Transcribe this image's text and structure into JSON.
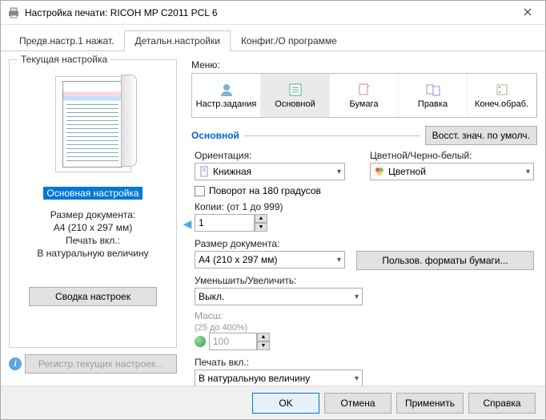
{
  "window": {
    "title": "Настройка печати: RICOH MP C2011 PCL 6"
  },
  "tabs": {
    "t1": "Предв.настр.1 нажат.",
    "t2": "Детальн.настройки",
    "t3": "Конфиг./О программе"
  },
  "left": {
    "group_title": "Текущая настройка",
    "highlight": "Основная настройка",
    "doc_size_label": "Размер документа:",
    "doc_size_value": "A4 (210 x 297 мм)",
    "print_on_label": "Печать вкл.:",
    "print_on_value": "В натуральную величину",
    "summary_btn": "Сводка настроек",
    "register_btn": "Регистр.текущих настроек..."
  },
  "menu": {
    "label": "Меню:",
    "items": {
      "job": "Настр.задания",
      "basic": "Основной",
      "paper": "Бумага",
      "edit": "Правка",
      "finish": "Конеч.обраб."
    }
  },
  "section": {
    "title": "Основной",
    "reset": "Восст. знач. по умолч."
  },
  "form": {
    "orientation_label": "Ориентация:",
    "orientation_value": "Книжная",
    "color_label": "Цветной/Черно-белый:",
    "color_value": "Цветной",
    "rotate_label": "Поворот на 180 градусов",
    "copies_label": "Копии: (от 1 до 999)",
    "copies_value": "1",
    "docsize_label": "Размер документа:",
    "docsize_value": "A4 (210 x 297 мм)",
    "custom_paper_btn": "Пользов. форматы бумаги...",
    "zoom_label": "Уменьшить/Увеличить:",
    "zoom_value": "Выкл.",
    "scale_label": "Масш:",
    "scale_range": "(25 до 400%)",
    "scale_value": "100",
    "printon_label": "Печать вкл.:",
    "printon_value": "В натуральную величину"
  },
  "footer": {
    "ok": "OK",
    "cancel": "Отмена",
    "apply": "Применить",
    "help": "Справка"
  }
}
